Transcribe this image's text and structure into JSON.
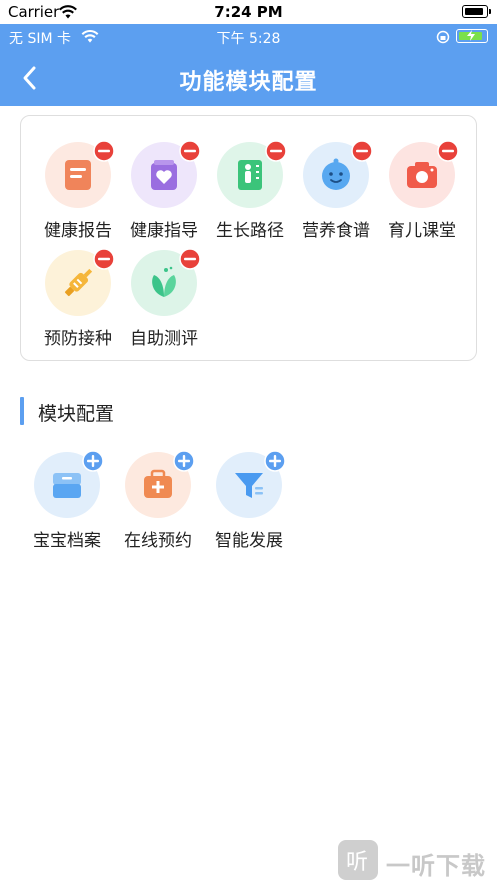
{
  "ios_status": {
    "carrier": "Carrier",
    "time": "7:24 PM"
  },
  "inner_status": {
    "sim": "无 SIM 卡",
    "time": "下午 5:28"
  },
  "header": {
    "title": "功能模块配置"
  },
  "selected_modules": [
    {
      "label": "健康报告",
      "icon": "report-icon",
      "color": "#f0845a",
      "bg": "#fde9e1"
    },
    {
      "label": "健康指导",
      "icon": "heart-bag-icon",
      "color": "#9a6ee0",
      "bg": "#eee6fb"
    },
    {
      "label": "生长路径",
      "icon": "growth-icon",
      "color": "#3bc47a",
      "bg": "#dff5e9"
    },
    {
      "label": "营养食谱",
      "icon": "baby-face-icon",
      "color": "#58a8f0",
      "bg": "#e1eefb"
    },
    {
      "label": "育儿课堂",
      "icon": "camera-icon",
      "color": "#f05b4a",
      "bg": "#fde4e1"
    },
    {
      "label": "预防接种",
      "icon": "syringe-icon",
      "color": "#f5b63a",
      "bg": "#fdf2d9"
    },
    {
      "label": "自助测评",
      "icon": "leaf-icon",
      "color": "#3cc48a",
      "bg": "#ddf4e8"
    }
  ],
  "section": {
    "title": "模块配置"
  },
  "available_modules": [
    {
      "label": "宝宝档案",
      "icon": "archive-icon",
      "color": "#5aa6f2",
      "bg": "#e1eefb"
    },
    {
      "label": "在线预约",
      "icon": "medkit-icon",
      "color": "#f08a52",
      "bg": "#fde9df"
    },
    {
      "label": "智能发展",
      "icon": "funnel-icon",
      "color": "#4a9af0",
      "bg": "#e1eefb"
    }
  ],
  "watermark": {
    "text": "一听下载"
  },
  "colors": {
    "header": "#5c9ff0",
    "remove_badge": "#e8413a",
    "add_badge": "#5c9ff0"
  }
}
